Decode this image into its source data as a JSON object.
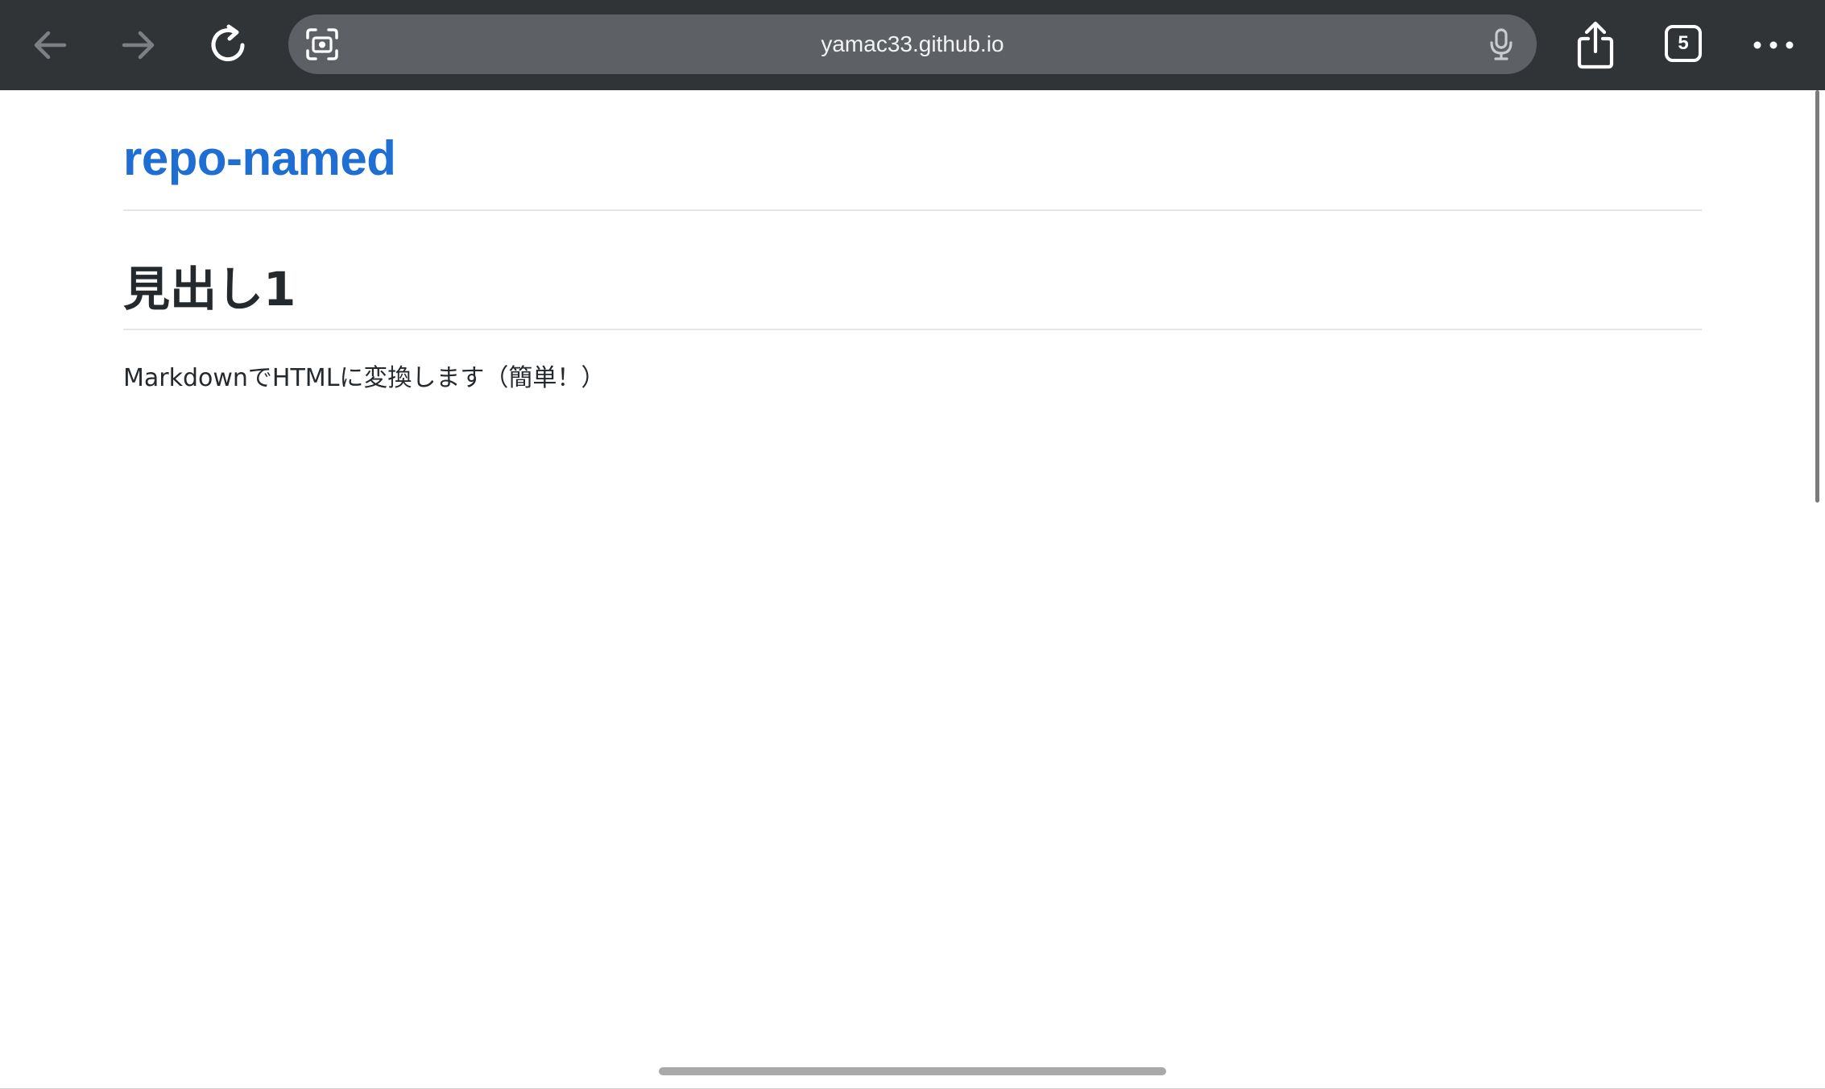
{
  "browser": {
    "url": "yamac33.github.io",
    "tab_count": "5",
    "icons": [
      "back-arrow-icon",
      "forward-arrow-icon",
      "reload-icon",
      "camera-search-icon",
      "microphone-icon",
      "share-icon",
      "tabs-icon",
      "more-icon"
    ]
  },
  "page": {
    "site_title": "repo-named",
    "heading1": "見出し1",
    "paragraph": "MarkdownでHTMLに変換します（簡単！）"
  },
  "colors": {
    "toolbar_bg": "#313437",
    "address_bar_bg": "#5d6165",
    "link_blue": "#1f6ed4",
    "text": "#24292e"
  }
}
